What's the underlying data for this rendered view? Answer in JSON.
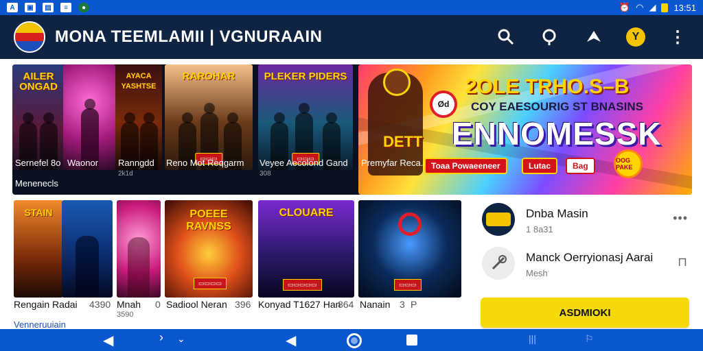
{
  "status_bar": {
    "time": "13:51",
    "icons": [
      "a-icon",
      "image-icon",
      "photo-icon",
      "notification-icon",
      "circle-app-icon"
    ],
    "right_icons": [
      "alarm-icon",
      "wifi-icon",
      "signal-icon",
      "battery-icon"
    ]
  },
  "app_bar": {
    "title": "MONA TEEMLAMII | VGNURAAIN",
    "actions": [
      "search-icon",
      "search-alt-icon",
      "cast-icon",
      "profile-icon",
      "more-vert-icon"
    ]
  },
  "row1": {
    "tiles": [
      {
        "header": "AILER ONGAD",
        "caption": "Sernefel 8o",
        "sub": ""
      },
      {
        "header": "",
        "caption": "Waonor",
        "sub": ""
      },
      {
        "header": "AYACA YASHTSE",
        "caption": "Ranngdd",
        "sub": "2k1d"
      },
      {
        "header": "RAROHAR",
        "caption": "Reno Mot Reqgarm",
        "sub": ""
      },
      {
        "header": "PLEKER PIDERS",
        "caption": "Veyee Aecolond Gand",
        "sub": "308"
      }
    ],
    "section_label": "Menenecls",
    "banner": {
      "title": "2OLE TRHO.S–B",
      "subtitle": "COY EAESOURIG ST BNASINS",
      "headline": "ENNOMESSK",
      "prefix": "DETT",
      "badge": "Ød",
      "caption": "Premyfar Reca..",
      "cta_primary": "Toaa Powaeeneer",
      "cta_secondary": "Lutac",
      "cta_icon_label": "Bag",
      "coin_text": "OOG PAKE"
    }
  },
  "row2": {
    "tiles": [
      {
        "header": "STAIN",
        "caption": "Rengain Radai",
        "sub": ""
      },
      {
        "header": "",
        "caption": "",
        "sub": ""
      },
      {
        "header": "",
        "caption": "Mnah",
        "sub": "3590"
      },
      {
        "header": "POEEE RAVNSS",
        "caption": "Sadiool Neran",
        "sub": ""
      },
      {
        "header": "CLOUARE",
        "caption": "Konyad T1627 Han",
        "sub": ""
      },
      {
        "header": "",
        "caption": "Nanain",
        "sub": ""
      }
    ],
    "numbers": [
      "4390",
      "0",
      "396",
      "864",
      "3",
      "P"
    ],
    "section_label": "Venneruuiain"
  },
  "side_panel": {
    "items": [
      {
        "name": "Dnba Masin",
        "meta": "1 8a31",
        "more": "•••"
      },
      {
        "name": "Manck Oerryionasj Aarai",
        "meta": "Mesh",
        "more": "⊓"
      }
    ],
    "primary_button": "ASDMIOKI"
  },
  "colors": {
    "status_bar": "#0b57d0",
    "app_bar": "#0e2442",
    "accent_yellow": "#f5d90a",
    "cta_red": "#d4121c"
  }
}
